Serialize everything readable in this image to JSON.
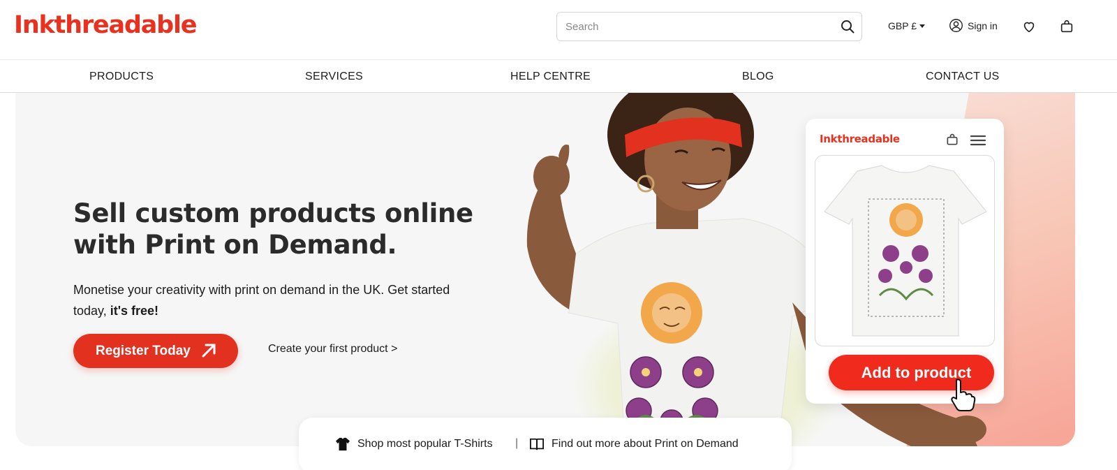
{
  "brand": {
    "name": "Inkthreadable",
    "accent": "#e8321f"
  },
  "header": {
    "search_placeholder": "Search",
    "currency": "GBP £",
    "signin_label": "Sign in",
    "icons": [
      "search-icon",
      "user-icon",
      "heart-icon",
      "bag-icon"
    ]
  },
  "nav": {
    "items": [
      {
        "label": "PRODUCTS"
      },
      {
        "label": "SERVICES"
      },
      {
        "label": "HELP CENTRE"
      },
      {
        "label": "BLOG"
      },
      {
        "label": "CONTACT US"
      }
    ]
  },
  "hero": {
    "headline_line1": "Sell custom products online",
    "headline_line2": "with Print on Demand.",
    "subcopy": "Monetise your creativity with print on demand in the UK. Get started today,",
    "subcopy_bold": "it's free!",
    "register_label": "Register Today",
    "create_link": "Create your first product >"
  },
  "mockup": {
    "logo": "Inkthreadable",
    "cta": "Add to product"
  },
  "bottom_links": {
    "shop_tshirts": "Shop most popular T-Shirts",
    "separator": "|",
    "find_out": "Find out more about Print on Demand"
  }
}
